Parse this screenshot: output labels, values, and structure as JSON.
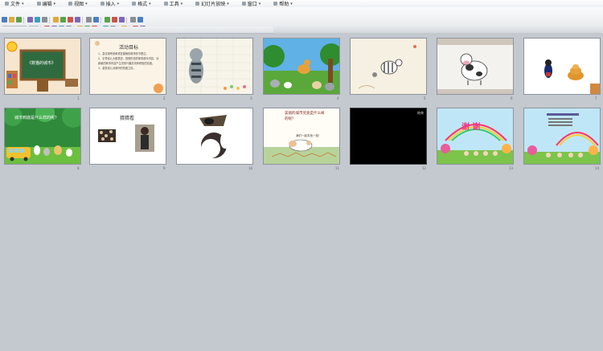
{
  "menu": [
    {
      "label": "文件",
      "icon": "file-icon"
    },
    {
      "label": "编辑",
      "icon": "edit-icon"
    },
    {
      "label": "视图",
      "icon": "view-icon"
    },
    {
      "label": "插入",
      "icon": "insert-icon"
    },
    {
      "label": "格式",
      "icon": "format-icon"
    },
    {
      "label": "工具",
      "icon": "tools-icon"
    },
    {
      "label": "幻灯片放映",
      "icon": "slideshow-icon"
    },
    {
      "label": "窗口",
      "icon": "window-icon"
    },
    {
      "label": "帮助",
      "icon": "help-icon"
    }
  ],
  "slides": [
    {
      "num": "1",
      "title": "《数猫的城市》"
    },
    {
      "num": "2",
      "title": "活动目标",
      "body": "1、尝试用夸张和重复替换的故事情节表达，\n2、引导幼儿大胆表述，感受形态的故事部分内容，对新颖的故事内容产生浓厚兴趣并具有积极的态度。\n3、激发幼儿对城市的热爱之情。"
    },
    {
      "num": "3"
    },
    {
      "num": "4"
    },
    {
      "num": "5"
    },
    {
      "num": "6"
    },
    {
      "num": "7"
    },
    {
      "num": "8",
      "title": "城市到底是什么样的呢？"
    },
    {
      "num": "9",
      "title": "猜猜看"
    },
    {
      "num": "10"
    },
    {
      "num": "11",
      "title": "美丽的城市究竟是什么样的呢？",
      "sub": "我们一起去找一找！"
    },
    {
      "num": "12",
      "label": "结束"
    },
    {
      "num": "13",
      "title": "谢 谢"
    },
    {
      "num": "14"
    }
  ],
  "colors": {
    "background": "#c4c8cf",
    "slide_border": "#8e949c"
  }
}
